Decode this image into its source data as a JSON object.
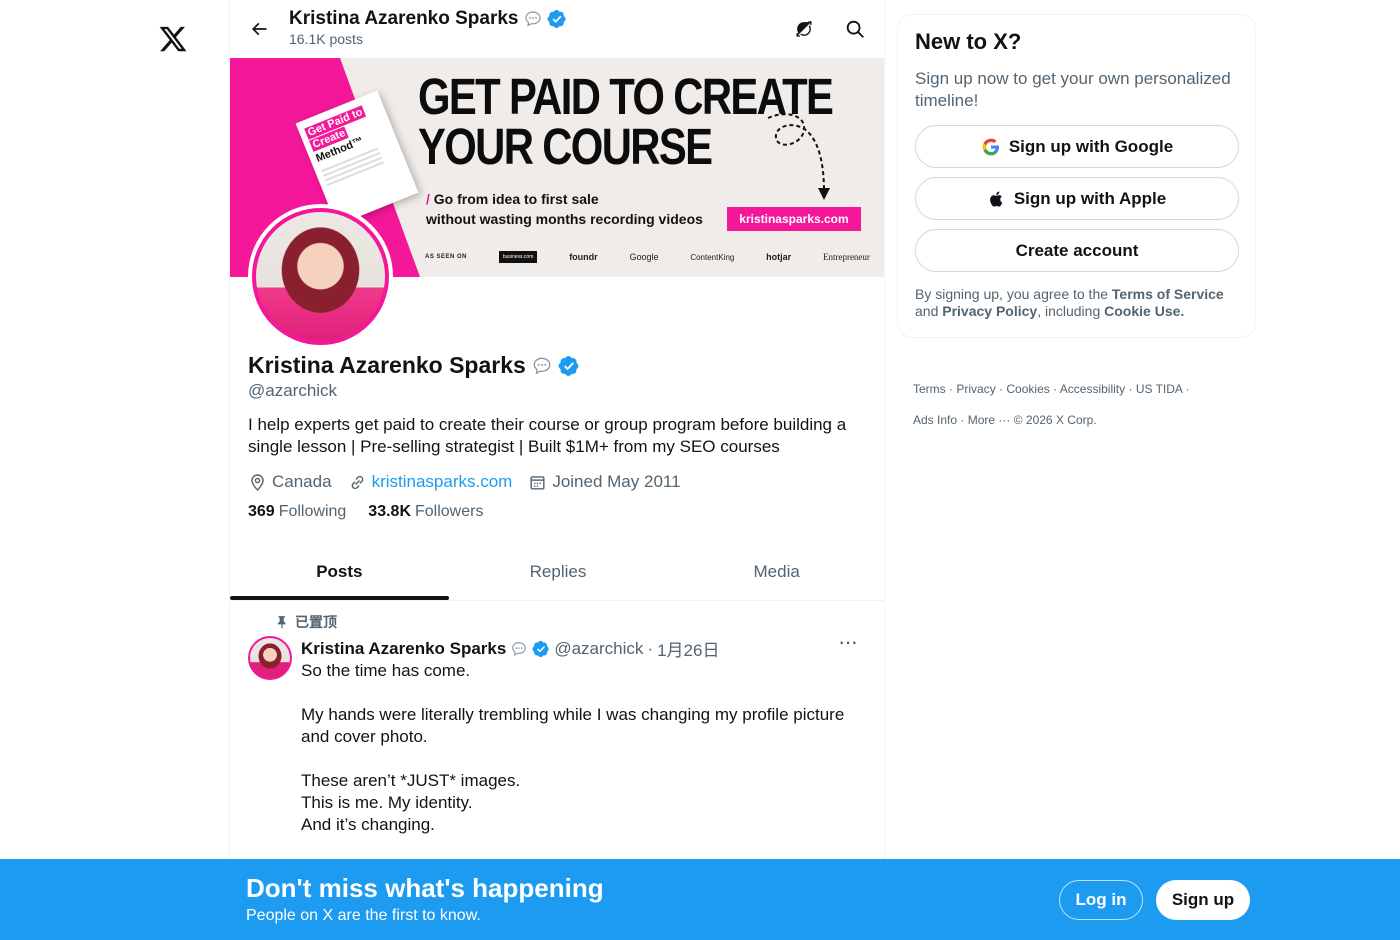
{
  "colors": {
    "accent": "#1d9bf0",
    "brand_pink": "#f5179a",
    "text": "#0f1419",
    "muted": "#536471"
  },
  "topbar": {
    "name": "Kristina Azarenko Sparks",
    "posts": "16.1K posts",
    "back_icon": "arrow-left-icon",
    "icons": [
      "refresh-icon",
      "search-icon"
    ]
  },
  "banner": {
    "book_title_1": "Get Paid to",
    "book_title_2": "Create",
    "book_sub": "Method™",
    "headline_1": "GET PAID TO CREATE",
    "headline_2": "YOUR COURSE",
    "sub_1": "Go from idea to first sale",
    "sub_slash": "/",
    "sub_2": "without wasting months recording videos",
    "url": "kristinasparks.com",
    "as_seen_on": "AS SEEN ON",
    "logos": [
      "business.com",
      "foundr",
      "Google",
      "ContentKing",
      "hotjar",
      "Entrepreneur"
    ]
  },
  "profile": {
    "name": "Kristina Azarenko Sparks",
    "handle": "@azarchick",
    "bio_1": "I help experts get paid to create their course or group program before building a",
    "bio_2": "single lesson | Pre-selling strategist | Built $1M+ from my SEO courses",
    "location": "Canada",
    "website": "kristinasparks.com",
    "joined": "Joined May 2011",
    "following_count": "369",
    "following_label": "Following",
    "followers_count": "33.8K",
    "followers_label": "Followers"
  },
  "tabs": [
    {
      "label": "Posts",
      "active": true
    },
    {
      "label": "Replies",
      "active": false
    },
    {
      "label": "Media",
      "active": false
    }
  ],
  "tweet": {
    "pinned_label": "已置顶",
    "name": "Kristina Azarenko Sparks",
    "handle": "@azarchick",
    "sep": "·",
    "date": "1月26日",
    "more": "···",
    "line_1": "So the time has come.",
    "line_2": "My hands were literally trembling while I was changing my profile picture",
    "line_3": "and cover photo.",
    "line_4": "These aren’t *JUST* images.",
    "line_5": "This is me. My identity.",
    "line_6": "And it’s changing."
  },
  "signup_card": {
    "title": "New to X?",
    "subtitle_1": "Sign up now to get your own personalized",
    "subtitle_2": "timeline!",
    "google_label": "Sign up with Google",
    "apple_label": "Sign up with Apple",
    "create_label": "Create account",
    "legal_prefix": "By signing up, you agree to the",
    "terms": "Terms of Service",
    "and": "and",
    "privacy": "Privacy Policy",
    "including": ", including",
    "cookie": "Cookie Use."
  },
  "footer": {
    "terms": "Terms",
    "privacy": "Privacy",
    "cookies": "Cookies",
    "accessibility": "Accessibility",
    "us_tida": "US TIDA",
    "ads_info": "Ads Info",
    "more": "More ···",
    "copyright": "© 2026 X Corp.",
    "sep": "·"
  },
  "bottom_bar": {
    "title": "Don't miss what's happening",
    "subtitle": "People on X are the first to know.",
    "login": "Log in",
    "signup": "Sign up"
  }
}
